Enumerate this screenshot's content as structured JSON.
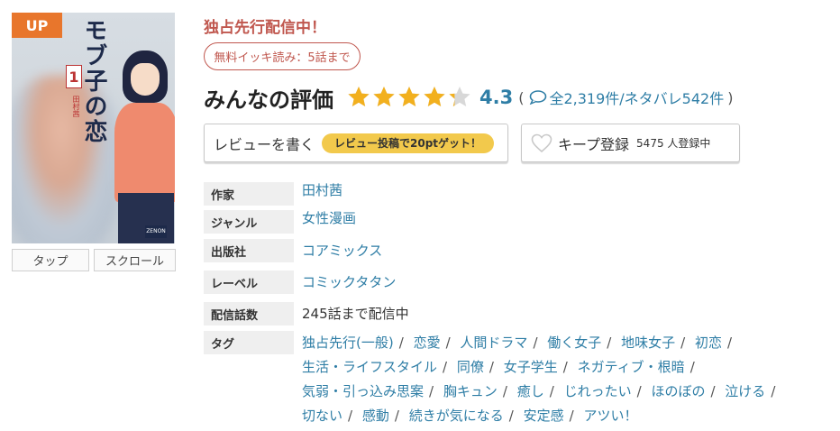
{
  "cover": {
    "badge": "UP",
    "title": "モブ子の恋",
    "volume": "1",
    "author_mini": "田村茜",
    "publisher_logo": "ZENON"
  },
  "view_buttons": {
    "tap": "タップ",
    "scroll": "スクロール"
  },
  "exclusive_label": "独占先行配信中！",
  "free_read_label": "無料イッキ読み：5話まで",
  "rating": {
    "title": "みんなの評価",
    "stars_value": 4.3,
    "stars_max": 5,
    "score": "4.3",
    "open_paren": "(",
    "counts": "全2,319件/ネタバレ542件",
    "close_paren": ")",
    "icon": "speech-bubble-icon",
    "star_color": "#f2b01e"
  },
  "review_button": {
    "label": "レビューを書く",
    "bonus": "レビュー投稿で20ptゲット！"
  },
  "keep_button": {
    "icon": "heart-icon",
    "label": "キープ登録",
    "count": "5475 人登録中"
  },
  "info": {
    "author_key": "作家",
    "author_val": "田村茜",
    "genre_key": "ジャンル",
    "genre_val": "女性漫画",
    "publisher_key": "出版社",
    "publisher_val": "コアミックス",
    "label_key": "レーベル",
    "label_val": "コミックタタン",
    "episodes_key": "配信話数",
    "episodes_val": "245話まで配信中",
    "tags_key": "タグ",
    "tags": [
      "独占先行(一般)",
      "恋愛",
      "人間ドラマ",
      "働く女子",
      "地味女子",
      "初恋",
      "生活・ライフスタイル",
      "同僚",
      "女子学生",
      "ネガティブ・根暗",
      "気弱・引っ込み思案",
      "胸キュン",
      "癒し",
      "じれったい",
      "ほのぼの",
      "泣ける",
      "切ない",
      "感動",
      "続きが気になる",
      "安定感",
      "アツい！"
    ]
  },
  "colors": {
    "accent_red": "#c0574e",
    "link_blue": "#2f7ea6",
    "badge_orange": "#e8762c",
    "pill_yellow": "#f2c94c"
  }
}
